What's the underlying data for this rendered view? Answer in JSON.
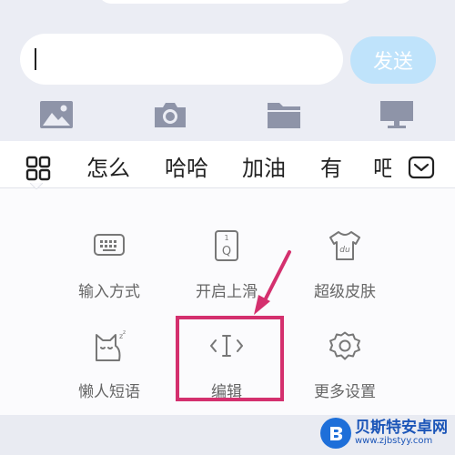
{
  "compose": {
    "input_value": "",
    "send_label": "发送"
  },
  "toolbar": {
    "icons": [
      "image-icon",
      "camera-icon",
      "folder-icon",
      "monitor-icon"
    ]
  },
  "candidates": {
    "menu_icon": "grid-icon",
    "words": [
      "怎么",
      "哈哈",
      "加油",
      "有",
      "吧"
    ],
    "collapse_icon": "chevron-down-icon"
  },
  "panel": {
    "items": [
      {
        "label": "输入方式",
        "icon": "keyboard-icon"
      },
      {
        "label": "开启上滑",
        "icon": "swipe-up-icon"
      },
      {
        "label": "超级皮肤",
        "icon": "skin-shirt-icon"
      },
      {
        "label": "懒人短语",
        "icon": "sleepy-cat-icon"
      },
      {
        "label": "编辑",
        "icon": "text-cursor-icon"
      },
      {
        "label": "更多设置",
        "icon": "gear-icon"
      }
    ]
  },
  "annotation": {
    "color": "#d4306e"
  },
  "watermark": {
    "title": "贝斯特安卓网",
    "url": "www.zjbstyy.com"
  },
  "colors": {
    "accent_send": "#bfe3fb",
    "icon_gray": "#8e94a8"
  }
}
